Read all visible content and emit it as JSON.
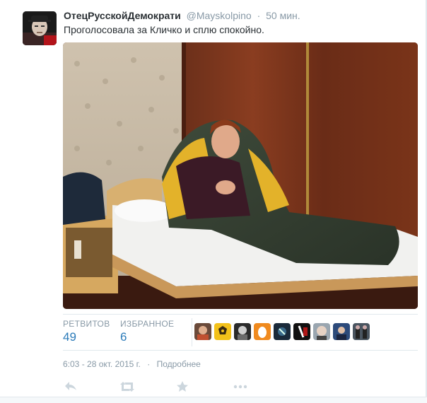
{
  "tweet": {
    "fullname": "ОтецРусскойДемократи",
    "username": "@Mayskolpino",
    "separator": "·",
    "time": "50 мин.",
    "text": "Проголосовала за Кличко и сплю спокойно."
  },
  "stats": {
    "retweets_label": "РЕТВИТОВ",
    "retweets_count": "49",
    "favorites_label": "ИЗБРАННОЕ",
    "favorites_count": "6"
  },
  "meta": {
    "timestamp": "6:03 - 28 окт. 2015 г.",
    "separator": "·",
    "details_link": "Подробнее"
  },
  "actions": [
    "reply-icon",
    "retweet-icon",
    "favorite-icon",
    "more-icon"
  ],
  "colors": {
    "link": "#2b7bb9",
    "muted": "#8899a6",
    "border": "#e1e8ed"
  }
}
